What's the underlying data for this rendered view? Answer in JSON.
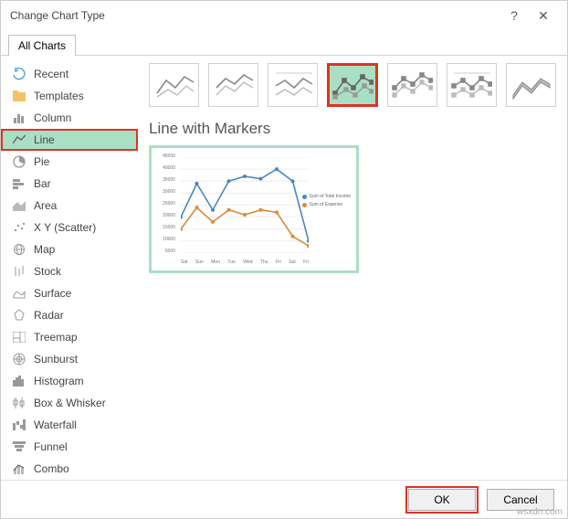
{
  "title": "Change Chart Type",
  "tab_label": "All Charts",
  "sidebar": {
    "items": [
      {
        "label": "Recent"
      },
      {
        "label": "Templates"
      },
      {
        "label": "Column"
      },
      {
        "label": "Line"
      },
      {
        "label": "Pie"
      },
      {
        "label": "Bar"
      },
      {
        "label": "Area"
      },
      {
        "label": "X Y (Scatter)"
      },
      {
        "label": "Map"
      },
      {
        "label": "Stock"
      },
      {
        "label": "Surface"
      },
      {
        "label": "Radar"
      },
      {
        "label": "Treemap"
      },
      {
        "label": "Sunburst"
      },
      {
        "label": "Histogram"
      },
      {
        "label": "Box & Whisker"
      },
      {
        "label": "Waterfall"
      },
      {
        "label": "Funnel"
      },
      {
        "label": "Combo"
      }
    ]
  },
  "selected_subtype_name": "Line with Markers",
  "legend": {
    "s1": "Sum of Total Income",
    "s2": "Sum of Expense"
  },
  "buttons": {
    "ok": "OK",
    "cancel": "Cancel"
  },
  "chart_data": {
    "type": "line",
    "categories": [
      "Sat",
      "Sun",
      "Mon",
      "Tue",
      "Wed",
      "Thu",
      "Fri",
      "Sat",
      "Fri"
    ],
    "series": [
      {
        "name": "Sum of Total Income",
        "color": "#4a86c5",
        "values": [
          20000,
          34000,
          23000,
          35000,
          37000,
          36000,
          40000,
          35000,
          10000
        ]
      },
      {
        "name": "Sum of Expense",
        "color": "#d98a3a",
        "values": [
          15000,
          24000,
          18000,
          23000,
          21000,
          23000,
          22000,
          12000,
          8000
        ]
      }
    ],
    "ylim": [
      5000,
      45000
    ],
    "yticks": [
      45000,
      40000,
      35000,
      30000,
      25000,
      20000,
      15000,
      10000,
      5000
    ],
    "title": "",
    "xlabel": "",
    "ylabel": ""
  },
  "watermark": "wsxdn.com"
}
